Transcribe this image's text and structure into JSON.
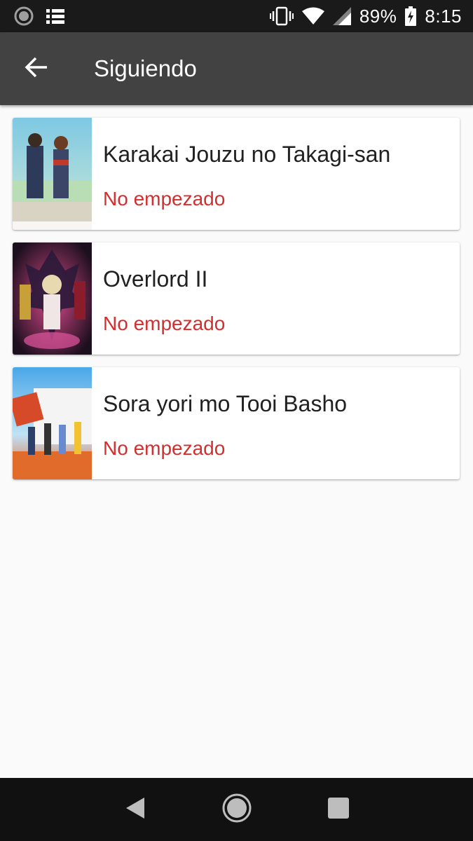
{
  "status_bar": {
    "battery": "89%",
    "time": "8:15",
    "icons": [
      "loading-icon",
      "list-icon",
      "vibrate-icon",
      "wifi-icon",
      "signal-icon",
      "battery-charging-icon"
    ]
  },
  "app_bar": {
    "back_icon": "arrow-back-icon",
    "title": "Siguiendo"
  },
  "items": [
    {
      "title": "Karakai Jouzu no Takagi-san",
      "status": "No empezado"
    },
    {
      "title": "Overlord II",
      "status": "No empezado"
    },
    {
      "title": "Sora yori mo Tooi Basho",
      "status": "No empezado"
    }
  ],
  "nav_bar": {
    "icons": [
      "back-triangle-icon",
      "home-circle-icon",
      "recents-square-icon"
    ]
  },
  "colors": {
    "status_bar": "#1a1a1a",
    "app_bar": "#424242",
    "status_text": "#d32f2f",
    "background": "#fafafa"
  }
}
